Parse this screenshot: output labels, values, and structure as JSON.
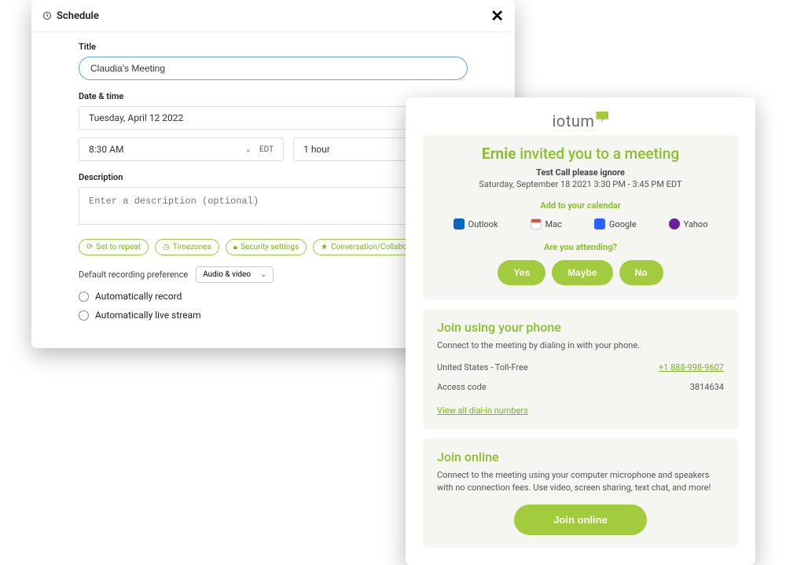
{
  "schedule": {
    "header_title": "Schedule",
    "labels": {
      "title": "Title",
      "datetime": "Date & time",
      "description": "Description",
      "default_recording": "Default recording preference"
    },
    "title_value": "Claudia's Meeting",
    "date_value": "Tuesday, April 12 2022",
    "time_value": "8:30 AM",
    "timezone": "EDT",
    "duration_value": "1 hour",
    "description_placeholder": "Enter a description (optional)",
    "chips": {
      "repeat": "Set to repeat",
      "timezones": "Timezones",
      "security": "Security settings",
      "mode": "Conversation/Collaboration mode"
    },
    "recording_select": "Audio & video",
    "radios": {
      "auto_record": "Automatically record",
      "auto_stream": "Automatically live stream"
    }
  },
  "invite": {
    "logo": "iotum",
    "headline_name": "Ernie",
    "headline_rest": "invited you to a meeting",
    "subject": "Test Call please ignore",
    "datetime": "Saturday, September 18 2021 3:30 PM - 3:45 PM EDT",
    "add_calendar_heading": "Add to your calendar",
    "calendars": {
      "outlook": "Outlook",
      "mac": "Mac",
      "google": "Google",
      "yahoo": "Yahoo"
    },
    "attending_heading": "Are you attending?",
    "rsvp": {
      "yes": "Yes",
      "maybe": "Maybe",
      "no": "No"
    },
    "phone": {
      "title": "Join using your phone",
      "desc": "Connect to the meeting by dialing in with your phone.",
      "country_label": "United States - Toll-Free",
      "number": "+1 888-998-9607",
      "access_label": "Access code",
      "access_code": "3814634",
      "view_all": "View all dial-in numbers"
    },
    "online": {
      "title": "Join online",
      "desc": "Connect to the meeting using your computer microphone and speakers with no connection fees. Use video, screen sharing, text chat, and more!",
      "button": "Join online"
    }
  }
}
